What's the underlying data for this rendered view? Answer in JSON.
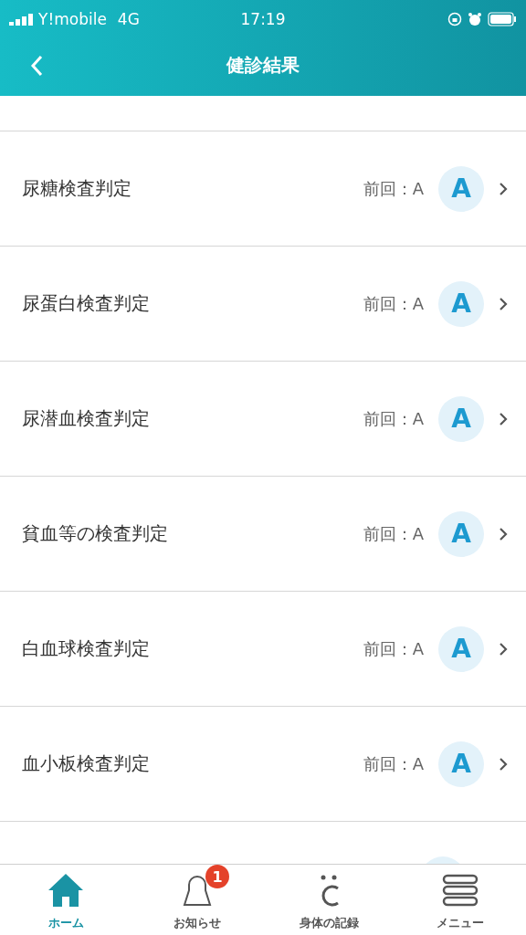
{
  "status_bar": {
    "carrier": "Y!mobile",
    "network": "4G",
    "time": "17:19"
  },
  "header": {
    "title": "健診結果"
  },
  "rows": [
    {
      "kind": "result",
      "label": "尿糖検査判定",
      "previous": "前回：A",
      "grade": "A"
    },
    {
      "kind": "result",
      "label": "尿蛋白検査判定",
      "previous": "前回：A",
      "grade": "A"
    },
    {
      "kind": "result",
      "label": "尿潜血検査判定",
      "previous": "前回：A",
      "grade": "A"
    },
    {
      "kind": "result",
      "label": "貧血等の検査判定",
      "previous": "前回：A",
      "grade": "A"
    },
    {
      "kind": "result",
      "label": "白血球検査判定",
      "previous": "前回：A",
      "grade": "A"
    },
    {
      "kind": "result",
      "label": "血小板検査判定",
      "previous": "前回：A",
      "grade": "A"
    },
    {
      "kind": "partial"
    }
  ],
  "tab_bar": [
    {
      "kind": "home",
      "label": "ホーム",
      "selected": true
    },
    {
      "kind": "bell",
      "label": "お知らせ",
      "selected": false,
      "badge": "1"
    },
    {
      "kind": "body",
      "label": "身体の記録",
      "selected": false
    },
    {
      "kind": "menu",
      "label": "メニュー",
      "selected": false
    }
  ]
}
